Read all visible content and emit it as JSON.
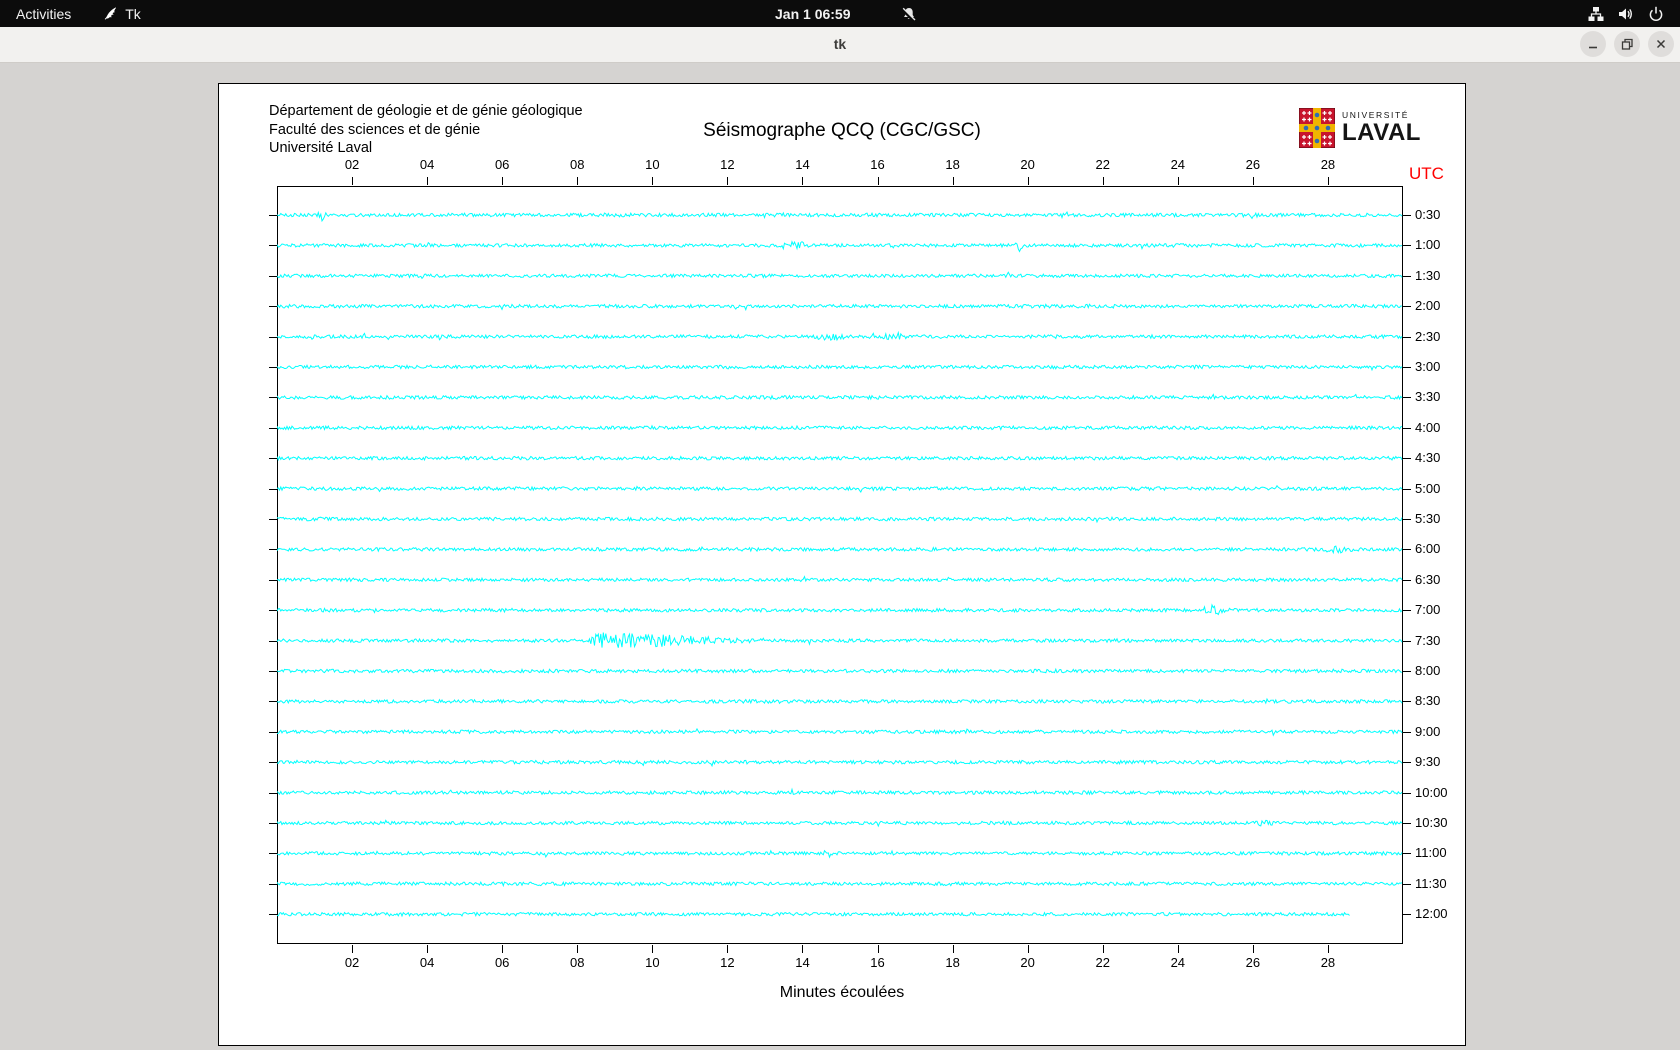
{
  "top_bar": {
    "activities_label": "Activities",
    "app_name": "Tk",
    "clock": "Jan 1  06:59"
  },
  "window": {
    "title": "tk"
  },
  "icons": {
    "app": "tk-feather",
    "notifications": "bell-slash",
    "network": "ethernet-tree",
    "volume": "speaker-waves",
    "power": "power-symbol",
    "minimize": "minimize-dash",
    "maximize": "restore-squares",
    "close": "close-x"
  },
  "header": {
    "dept_lines": [
      "Département de géologie et de génie géologique",
      "Faculté des sciences et de génie",
      "Université Laval"
    ],
    "title": "Séismographe QCQ (CGC/GSC)",
    "logo": {
      "line1": "UNIVERSITÉ",
      "line2": "LAVAL"
    }
  },
  "chart_data": {
    "type": "line",
    "subtype": "seismograph-helicorder",
    "title": "Séismographe QCQ (CGC/GSC)",
    "xlabel": "Minutes écoulées",
    "utc_label": "UTC",
    "x_ticks": [
      "02",
      "04",
      "06",
      "08",
      "10",
      "12",
      "14",
      "16",
      "18",
      "20",
      "22",
      "24",
      "26",
      "28"
    ],
    "x_range_minutes": [
      0,
      30
    ],
    "minutes_per_row": 30,
    "trace_color": "#00ffff",
    "utc_color": "#ff0000",
    "grid": false,
    "rows": [
      {
        "utc": "0:30",
        "events": [
          {
            "type": "spike",
            "t": 1.2,
            "w": 0.05,
            "a": 7
          }
        ]
      },
      {
        "utc": "1:00",
        "events": [
          {
            "type": "blob",
            "t": 13.7,
            "w": 0.25,
            "a": 2.5
          },
          {
            "type": "spike",
            "t": 19.8,
            "w": 0.06,
            "a": 5
          }
        ]
      },
      {
        "utc": "1:30",
        "events": []
      },
      {
        "utc": "2:00",
        "events": []
      },
      {
        "utc": "2:30",
        "events": [
          {
            "type": "blob",
            "t": 14.7,
            "w": 0.3,
            "a": 2.2
          },
          {
            "type": "blob",
            "t": 16.4,
            "w": 0.25,
            "a": 2.6
          }
        ]
      },
      {
        "utc": "3:00",
        "events": []
      },
      {
        "utc": "3:30",
        "events": []
      },
      {
        "utc": "4:00",
        "events": []
      },
      {
        "utc": "4:30",
        "events": []
      },
      {
        "utc": "5:00",
        "events": []
      },
      {
        "utc": "5:30",
        "events": []
      },
      {
        "utc": "6:00",
        "events": [
          {
            "type": "blob",
            "t": 28.2,
            "w": 0.2,
            "a": 3.5
          }
        ]
      },
      {
        "utc": "6:30",
        "events": []
      },
      {
        "utc": "7:00",
        "events": [
          {
            "type": "burst",
            "t0": 24.6,
            "t1": 25.6,
            "a": 6
          }
        ]
      },
      {
        "utc": "7:30",
        "events": [
          {
            "type": "burst",
            "t0": 8.3,
            "t1": 13.0,
            "a": 9
          }
        ]
      },
      {
        "utc": "8:00",
        "events": []
      },
      {
        "utc": "8:30",
        "events": []
      },
      {
        "utc": "9:00",
        "events": []
      },
      {
        "utc": "9:30",
        "events": []
      },
      {
        "utc": "10:00",
        "events": []
      },
      {
        "utc": "10:30",
        "events": [
          {
            "type": "blob",
            "t": 26.3,
            "w": 0.15,
            "a": 2
          }
        ]
      },
      {
        "utc": "11:00",
        "events": []
      },
      {
        "utc": "11:30",
        "events": []
      },
      {
        "utc": "12:00",
        "events": [],
        "end_minute": 28.6
      }
    ]
  }
}
